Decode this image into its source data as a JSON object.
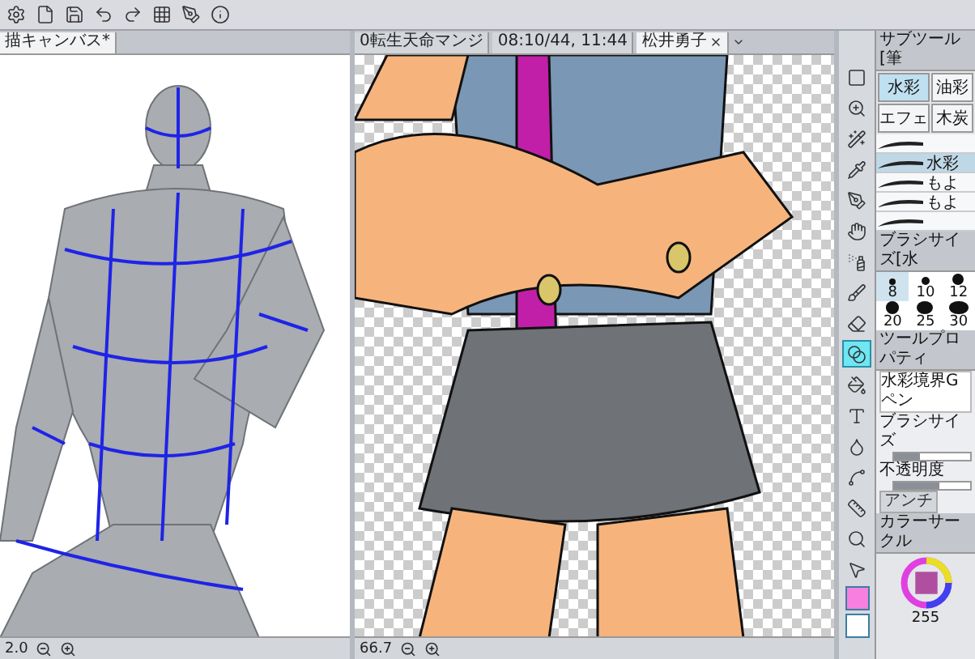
{
  "left_canvas": {
    "tab": "描キャンバス*",
    "zoom": "2.0"
  },
  "middle_canvas": {
    "tabs": [
      {
        "label": "0転生天命マンジ",
        "selected": false
      },
      {
        "label": "08:10/44, 11:44",
        "selected": false
      },
      {
        "label": "松井勇子",
        "selected": true
      }
    ],
    "zoom": "66.7"
  },
  "tools": [
    {
      "kind": "select",
      "selected": false
    },
    {
      "kind": "zoom",
      "selected": false
    },
    {
      "kind": "wand",
      "selected": false
    },
    {
      "kind": "pipette",
      "selected": false
    },
    {
      "kind": "pen",
      "selected": false
    },
    {
      "kind": "hand",
      "selected": false
    },
    {
      "kind": "spray",
      "selected": false
    },
    {
      "kind": "brush",
      "selected": false
    },
    {
      "kind": "eraser",
      "selected": false
    },
    {
      "kind": "blend",
      "selected": true
    },
    {
      "kind": "fill",
      "selected": false
    },
    {
      "kind": "text",
      "selected": false
    },
    {
      "kind": "gradient",
      "selected": false
    },
    {
      "kind": "curve",
      "selected": false
    },
    {
      "kind": "ruler",
      "selected": false
    },
    {
      "kind": "search",
      "selected": false
    },
    {
      "kind": "pointer",
      "selected": false
    }
  ],
  "color_swatches": [
    {
      "color": "#f77fe0"
    },
    {
      "color": "#ffffff"
    }
  ],
  "subtool": {
    "title": "サブツール[筆",
    "tabs": [
      {
        "label": "水彩",
        "selected": true
      },
      {
        "label": "油彩",
        "selected": false
      },
      {
        "label": "エフェ",
        "selected": false
      },
      {
        "label": "木炭",
        "selected": false
      }
    ],
    "brushes": [
      {
        "selected": false
      },
      {
        "label": "水彩",
        "selected": true
      },
      {
        "label": "もよ",
        "selected": false
      },
      {
        "label": "もよ",
        "selected": false
      },
      {
        "selected": false
      }
    ]
  },
  "brush_size": {
    "title": "ブラシサイズ[水",
    "sizes": [
      {
        "label": "8",
        "selected": true
      },
      {
        "label": "10",
        "selected": false
      },
      {
        "label": "12",
        "selected": false
      },
      {
        "label": "20",
        "selected": false
      },
      {
        "label": "25",
        "selected": false
      },
      {
        "label": "30",
        "selected": false
      }
    ]
  },
  "tool_property": {
    "title": "ツールプロパティ",
    "tool_name": "水彩境界Gペン",
    "rows": [
      {
        "label": "ブラシサイズ",
        "level": 0.35
      },
      {
        "label": "不透明度",
        "level": 0.6
      }
    ],
    "tab": "アンチ"
  },
  "color_circle": {
    "title": "カラーサークル",
    "readout": "255"
  }
}
